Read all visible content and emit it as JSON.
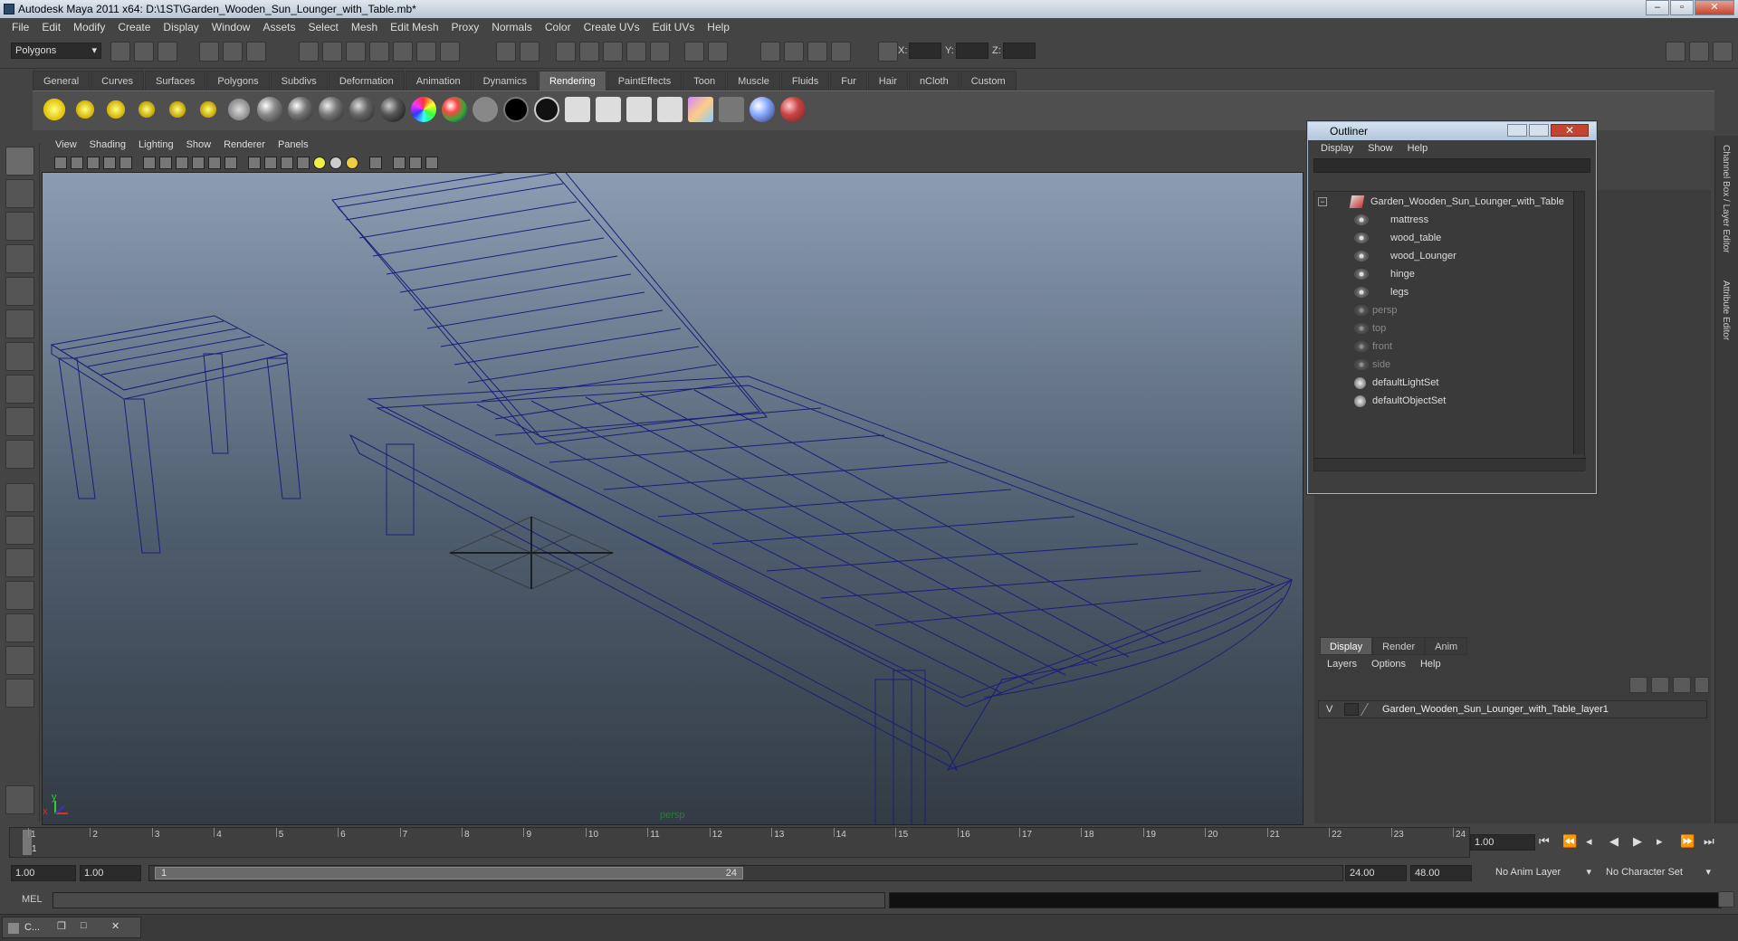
{
  "window": {
    "title": "Autodesk Maya 2011 x64: D:\\1ST\\Garden_Wooden_Sun_Lounger_with_Table.mb*",
    "min": "–",
    "max": "▫",
    "close": "✕"
  },
  "menubar": [
    "File",
    "Edit",
    "Modify",
    "Create",
    "Display",
    "Window",
    "Assets",
    "Select",
    "Mesh",
    "Edit Mesh",
    "Proxy",
    "Normals",
    "Color",
    "Create UVs",
    "Edit UVs",
    "Help"
  ],
  "statusline": {
    "mode": "Polygons",
    "x_label": "X:",
    "y_label": "Y:",
    "z_label": "Z:"
  },
  "shelf_tabs": [
    "General",
    "Curves",
    "Surfaces",
    "Polygons",
    "Subdivs",
    "Deformation",
    "Animation",
    "Dynamics",
    "Rendering",
    "PaintEffects",
    "Toon",
    "Muscle",
    "Fluids",
    "Fur",
    "Hair",
    "nCloth",
    "Custom"
  ],
  "shelf_active": "Rendering",
  "viewport": {
    "menu": [
      "View",
      "Shading",
      "Lighting",
      "Show",
      "Renderer",
      "Panels"
    ],
    "camera_label": "persp",
    "axis_x": "x",
    "axis_y": "y",
    "wire_color": "#1a1f78"
  },
  "outliner": {
    "title": "Outliner",
    "menu": [
      "Display",
      "Show",
      "Help"
    ],
    "expand_glyph": "−",
    "root": "Garden_Wooden_Sun_Lounger_with_Table",
    "children": [
      "mattress",
      "wood_table",
      "wood_Lounger",
      "hinge",
      "legs"
    ],
    "cameras": [
      "persp",
      "top",
      "front",
      "side"
    ],
    "sets": [
      "defaultLightSet",
      "defaultObjectSet"
    ]
  },
  "layer_editor": {
    "tabs": [
      "Display",
      "Render",
      "Anim"
    ],
    "active_tab": "Display",
    "menu": [
      "Layers",
      "Options",
      "Help"
    ],
    "visible_flag": "V",
    "layer_name": "Garden_Wooden_Sun_Lounger_with_Table_layer1"
  },
  "side_tabs": [
    "Channel Box / Layer Editor",
    "Attribute Editor"
  ],
  "timeline": {
    "ticks": [
      "1",
      "2",
      "3",
      "4",
      "5",
      "6",
      "7",
      "8",
      "9",
      "10",
      "11",
      "12",
      "13",
      "14",
      "15",
      "16",
      "17",
      "18",
      "19",
      "20",
      "21",
      "22",
      "23",
      "24"
    ],
    "current_time": "1.00",
    "current_frame_marker": "1"
  },
  "range": {
    "start": "1.00",
    "inner_start": "1.00",
    "slider_start": "1",
    "slider_end": "24",
    "end": "24.00",
    "outer_end": "48.00",
    "anim_layer": "No Anim Layer",
    "character_set": "No Character Set"
  },
  "cmdline": {
    "label": "MEL"
  },
  "taskbar": {
    "item": "C..."
  }
}
